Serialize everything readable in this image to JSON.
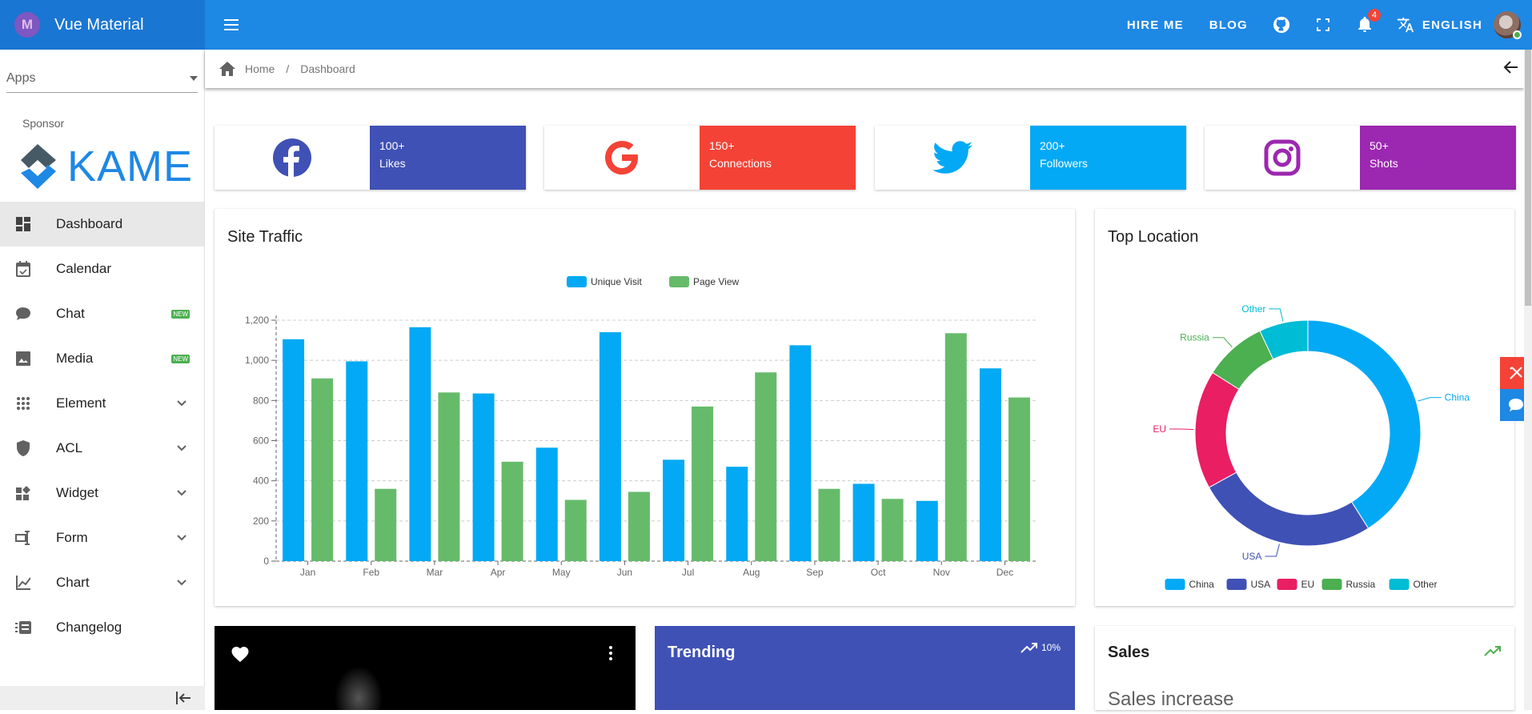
{
  "app": {
    "title": "Vue Material",
    "logo_letter": "M"
  },
  "topbar": {
    "hire_me": "HIRE ME",
    "blog": "BLOG",
    "notifications_count": "4",
    "language": "ENGLISH"
  },
  "sidebar": {
    "apps_label": "Apps",
    "sponsor_label": "Sponsor",
    "sponsor_name": "KAME",
    "items": [
      {
        "label": "Dashboard",
        "icon": "dashboard-icon",
        "active": true
      },
      {
        "label": "Calendar",
        "icon": "calendar-icon"
      },
      {
        "label": "Chat",
        "icon": "chat-icon",
        "badge": "NEW"
      },
      {
        "label": "Media",
        "icon": "image-icon",
        "badge": "NEW"
      },
      {
        "label": "Element",
        "icon": "apps-icon",
        "expandable": true
      },
      {
        "label": "ACL",
        "icon": "shield-icon",
        "expandable": true
      },
      {
        "label": "Widget",
        "icon": "widgets-icon",
        "expandable": true
      },
      {
        "label": "Form",
        "icon": "form-icon",
        "expandable": true
      },
      {
        "label": "Chart",
        "icon": "chart-icon",
        "expandable": true
      },
      {
        "label": "Changelog",
        "icon": "changelog-icon"
      }
    ]
  },
  "breadcrumb": {
    "home": "Home",
    "separator": "/",
    "current": "Dashboard"
  },
  "stats": [
    {
      "value": "100+",
      "label": "Likes",
      "icon": "facebook-icon",
      "color": "#3f51b5",
      "icon_color": "#3f51b5"
    },
    {
      "value": "150+",
      "label": "Connections",
      "icon": "google-icon",
      "color": "#f44336",
      "icon_color": "#f44336"
    },
    {
      "value": "200+",
      "label": "Followers",
      "icon": "twitter-icon",
      "color": "#03a9f4",
      "icon_color": "#03a9f4"
    },
    {
      "value": "50+",
      "label": "Shots",
      "icon": "instagram-icon",
      "color": "#9c27b0",
      "icon_color": "#9c27b0"
    }
  ],
  "site_traffic": {
    "title": "Site Traffic"
  },
  "top_location": {
    "title": "Top Location"
  },
  "chart_data": [
    {
      "type": "bar",
      "title": "Site Traffic",
      "categories": [
        "Jan",
        "Feb",
        "Mar",
        "Apr",
        "May",
        "Jun",
        "Jul",
        "Aug",
        "Sep",
        "Oct",
        "Nov",
        "Dec"
      ],
      "series": [
        {
          "name": "Unique Visit",
          "color": "#03a9f4",
          "values": [
            1105,
            995,
            1165,
            835,
            565,
            1140,
            505,
            470,
            1075,
            385,
            300,
            960
          ]
        },
        {
          "name": "Page View",
          "color": "#66bb6a",
          "values": [
            910,
            360,
            840,
            495,
            305,
            345,
            770,
            940,
            360,
            310,
            1135,
            815
          ]
        }
      ],
      "ylim": [
        0,
        1200
      ],
      "yticks": [
        "0",
        "200",
        "400",
        "600",
        "800",
        "1,000",
        "1,200"
      ],
      "grid": true,
      "legend": "top"
    },
    {
      "type": "pie",
      "title": "Top Location",
      "labels": [
        "China",
        "USA",
        "EU",
        "Russia",
        "Other"
      ],
      "values": [
        41,
        26,
        17,
        9,
        7
      ],
      "colors": [
        "#03a9f4",
        "#3f51b5",
        "#e91e63",
        "#4caf50",
        "#00bcd4"
      ],
      "legend": "bottom"
    }
  ],
  "trending": {
    "title": "Trending",
    "percent": "10%"
  },
  "sales": {
    "title": "Sales",
    "subtitle": "Sales increase"
  }
}
